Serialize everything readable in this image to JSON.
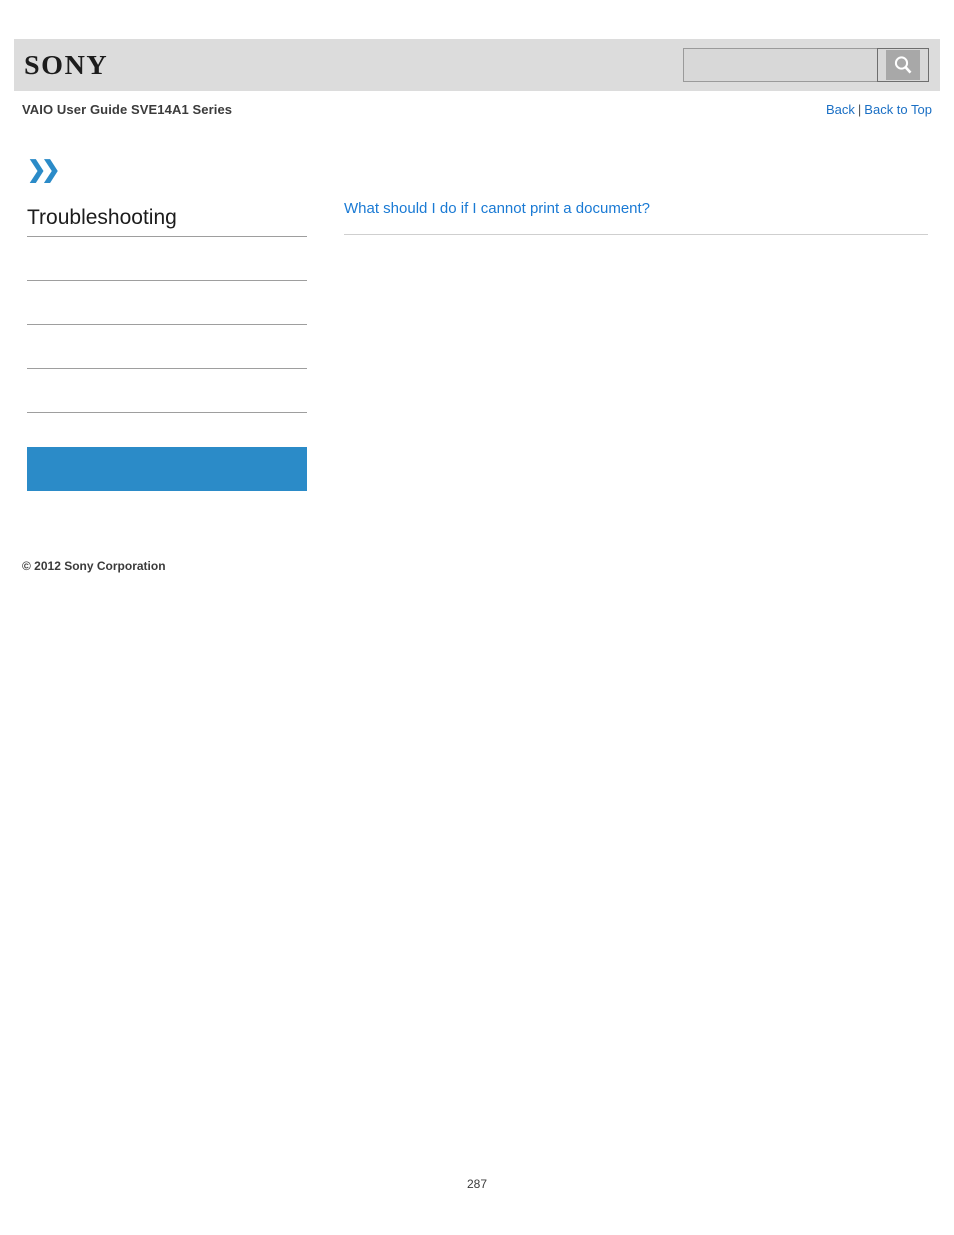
{
  "header": {
    "logo_text": "SONY",
    "search": {
      "value": "",
      "placeholder": "",
      "icon": "search-icon",
      "button_label": ""
    },
    "guide_title": "VAIO User Guide SVE14A1 Series",
    "links": {
      "back": "Back",
      "separator": "|",
      "back_to_top": "Back to Top"
    }
  },
  "sidebar": {
    "breadcrumb_arrow_icon": "double-chevron-right-icon",
    "title": "Troubleshooting",
    "items": [
      {
        "label": ""
      },
      {
        "label": ""
      },
      {
        "label": ""
      },
      {
        "label": ""
      }
    ],
    "highlight": {
      "label": ""
    },
    "copyright": "© 2012 Sony Corporation"
  },
  "main": {
    "topics": [
      {
        "label": "What should I do if I cannot print a document?"
      }
    ]
  },
  "footer": {
    "page_number": "287"
  },
  "colors": {
    "accent_blue": "#2b8bc8",
    "link_blue": "#1a7ad4",
    "header_band": "#dcdcdc",
    "rule_gray": "#9e9e9e"
  }
}
